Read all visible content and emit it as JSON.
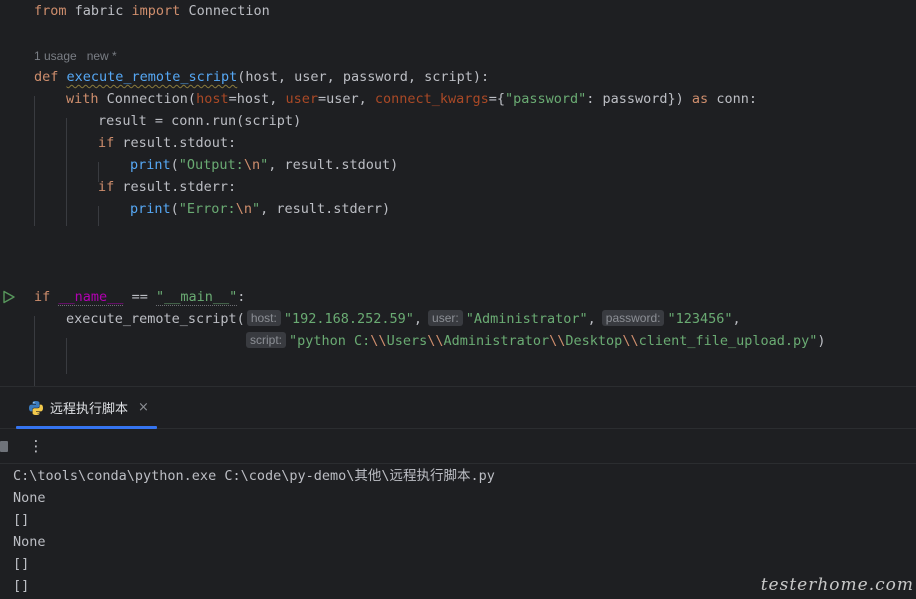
{
  "editor": {
    "usage_hint": "1 usage",
    "new_hint": "new *",
    "line_import": {
      "from": "from",
      "module": " fabric ",
      "import": "import",
      "name": " Connection"
    },
    "line_def": {
      "def": "def",
      "fn": "execute_remote_script",
      "params": "(host, user, password, script):"
    },
    "line_with": {
      "with": "with",
      "call_open": " Connection(",
      "host_kw": "host",
      "host_val": "=host, ",
      "user_kw": "user",
      "user_val": "=user, ",
      "ck_kw": "connect_kwargs",
      "ck_open": "={",
      "pw_key": "\"password\"",
      "ck_close": ": password}) ",
      "as": "as",
      "conn": " conn:"
    },
    "line_result": "result = conn.run(script)",
    "line_if_out": {
      "if": "if",
      "rest": " result.stdout:"
    },
    "line_print_out": {
      "fn": "print",
      "open": "(",
      "s1": "\"Output:",
      "esc": "\\n",
      "s2": "\"",
      "rest": ", result.stdout)"
    },
    "line_if_err": {
      "if": "if",
      "rest": " result.stderr:"
    },
    "line_print_err": {
      "fn": "print",
      "open": "(",
      "s1": "\"Error:",
      "esc": "\\n",
      "s2": "\"",
      "rest": ", result.stderr)"
    },
    "line_main": {
      "if": "if",
      "sp": " ",
      "name": "__name__",
      "eq": " == ",
      "str": "\"__main__\"",
      "colon": ":"
    },
    "line_call1": {
      "fn": "execute_remote_script(",
      "host_hint": "host:",
      "host_val": "\"192.168.252.59\"",
      "sep1": ",",
      "user_hint": "user:",
      "user_val": "\"Administrator\"",
      "sep2": ",",
      "password_hint": "password:",
      "password_val": "\"123456\"",
      "sep3": ","
    },
    "line_call2": {
      "script_hint": "script:",
      "s_a": "\"python C:",
      "e1": "\\\\",
      "s_b": "Users",
      "e2": "\\\\",
      "s_c": "Administrator",
      "e3": "\\\\",
      "s_d": "Desktop",
      "e4": "\\\\",
      "s_e": "client_file_upload.py\"",
      "close": ")"
    }
  },
  "run_panel": {
    "tab_label": "远程执行脚本",
    "tab_close": "×",
    "more_icon": "⋮",
    "console_lines": [
      "C:\\tools\\conda\\python.exe C:\\code\\py-demo\\其他\\远程执行脚本.py",
      "None",
      "[]",
      "None",
      "[]",
      "[]"
    ]
  },
  "watermark": "testerhome.com",
  "colors": {
    "background": "#1e1f22",
    "keyword": "#cf8e6d",
    "function": "#56a8f5",
    "string": "#6aab73",
    "named_param": "#aa4926",
    "dunder": "#b200b2",
    "tab_underline": "#3574f0"
  }
}
